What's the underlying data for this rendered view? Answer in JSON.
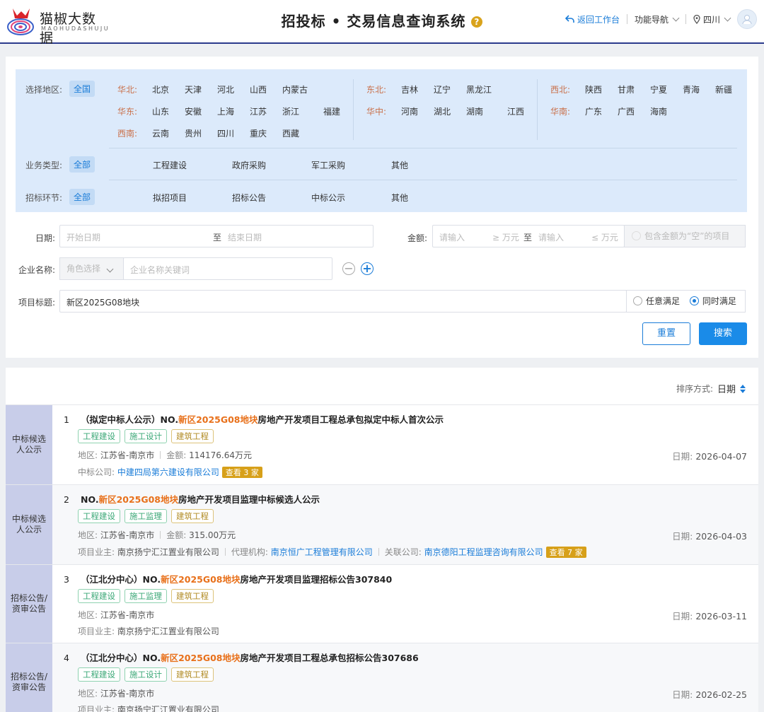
{
  "header": {
    "logo_text": "猫椒大数据",
    "logo_sub": "MAOHUDASHUJU",
    "title": "招投标 • 交易信息查询系统",
    "help": "?",
    "back": "返回工作台",
    "nav": "功能导航",
    "region": "四川"
  },
  "filters": {
    "region_label": "选择地区:",
    "region_all": "全国",
    "regions": [
      {
        "group": "华北:",
        "items": [
          "北京",
          "天津",
          "河北",
          "山西",
          "内蒙古"
        ]
      },
      {
        "group": "东北:",
        "items": [
          "吉林",
          "辽宁",
          "黑龙江"
        ]
      },
      {
        "group": "西北:",
        "items": [
          "陕西",
          "甘肃",
          "宁夏",
          "青海",
          "新疆"
        ]
      },
      {
        "group": "华东:",
        "items": [
          "山东",
          "安徽",
          "上海",
          "江苏",
          "浙江",
          "福建"
        ]
      },
      {
        "group": "华中:",
        "items": [
          "河南",
          "湖北",
          "湖南",
          "江西"
        ]
      },
      {
        "group": "华南:",
        "items": [
          "广东",
          "广西",
          "海南"
        ]
      },
      {
        "group": "西南:",
        "items": [
          "云南",
          "贵州",
          "四川",
          "重庆",
          "西藏"
        ]
      }
    ],
    "biz_label": "业务类型:",
    "biz_all": "全部",
    "biz_items": [
      "工程建设",
      "政府采购",
      "军工采购",
      "其他"
    ],
    "stage_label": "招标环节:",
    "stage_all": "全部",
    "stage_items": [
      "拟招项目",
      "招标公告",
      "中标公示",
      "其他"
    ],
    "date_label": "日期:",
    "date_start_ph": "开始日期",
    "date_to": "至",
    "date_end_ph": "结束日期",
    "amount_label": "金额:",
    "amount_min_ph": "请输入",
    "amount_min_unit": "≥ 万元",
    "amount_to": "至",
    "amount_max_ph": "请输入",
    "amount_max_unit": "≤ 万元",
    "amount_empty": "包含金额为“空”的项目",
    "company_label": "企业名称:",
    "role_ph": "角色选择",
    "company_ph": "企业名称关键词",
    "title_label": "项目标题:",
    "title_value": "新区2025G08地块",
    "match_any": "任意满足",
    "match_all": "同时满足",
    "reset": "重置",
    "search": "搜索"
  },
  "results": {
    "sort_label": "排序方式:",
    "sort_value": "日期",
    "items": [
      {
        "category": "中标候选人公示",
        "num": "1",
        "prefix": "（拟定中标人公示）NO.",
        "highlight": "新区2025G08地块",
        "suffix": "房地产开发项目工程总承包拟定中标人首次公示",
        "tags": [
          "工程建设",
          "施工设计",
          "建筑工程"
        ],
        "region_label": "地区:",
        "region": "江苏省-南京市",
        "amount_label": "金额:",
        "amount": "114176.64万元",
        "extra_label": "中标公司:",
        "extra": "中建四局第六建设有限公司",
        "count": "查看 3 家",
        "date_label": "日期:",
        "date": "2026-04-07"
      },
      {
        "category": "中标候选人公示",
        "num": "2",
        "prefix": "NO.",
        "highlight": "新区2025G08地块",
        "suffix": "房地产开发项目监理中标候选人公示",
        "tags": [
          "工程建设",
          "施工监理",
          "建筑工程"
        ],
        "region_label": "地区:",
        "region": "江苏省-南京市",
        "amount_label": "金额:",
        "amount": "315.00万元",
        "owner_label": "项目业主:",
        "owner": "南京扬宁汇江置业有限公司",
        "agent_label": "代理机构:",
        "agent": "南京恒广工程管理有限公司",
        "rel_label": "关联公司:",
        "rel": "南京德阳工程监理咨询有限公司",
        "count": "查看 7 家",
        "date_label": "日期:",
        "date": "2026-04-03"
      },
      {
        "category": "招标公告/资审公告",
        "num": "3",
        "prefix": "（江北分中心）NO.",
        "highlight": "新区2025G08地块",
        "suffix": "房地产开发项目监理招标公告307840",
        "tags": [
          "工程建设",
          "施工监理",
          "建筑工程"
        ],
        "region_label": "地区:",
        "region": "江苏省-南京市",
        "owner_label": "项目业主:",
        "owner": "南京扬宁汇江置业有限公司",
        "date_label": "日期:",
        "date": "2026-03-11"
      },
      {
        "category": "招标公告/资审公告",
        "num": "4",
        "prefix": "（江北分中心）NO.",
        "highlight": "新区2025G08地块",
        "suffix": "房地产开发项目工程总承包招标公告307686",
        "tags": [
          "工程建设",
          "施工设计",
          "建筑工程"
        ],
        "region_label": "地区:",
        "region": "江苏省-南京市",
        "owner_label": "项目业主:",
        "owner": "南京扬宁汇江置业有限公司",
        "date_label": "日期:",
        "date": "2026-02-25"
      }
    ]
  },
  "colors": {
    "accent": "#1a7cd8",
    "highlight": "#e8701a",
    "panel": "#dceafb",
    "category_bg": "#c8cde9"
  }
}
